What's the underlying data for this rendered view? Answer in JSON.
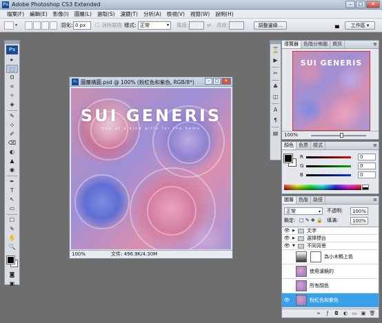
{
  "window": {
    "title": "Adobe Photoshop CS3 Extended",
    "logo": "Ps",
    "controls": [
      "–",
      "□",
      "✕"
    ]
  },
  "menu": [
    "檔案(F)",
    "編輯(E)",
    "影像(I)",
    "圖層(L)",
    "選取(S)",
    "濾鏡(T)",
    "分析(A)",
    "檢視(V)",
    "視窗(W)",
    "說明(H)"
  ],
  "options": {
    "feather_label": "羽化:",
    "feather_value": "0 px",
    "antialias_label": "消除鋸齒",
    "style_label": "樣式:",
    "style_value": "正常",
    "width_label": "寬度:",
    "height_label": "高度:",
    "refine_edge_button": "調整邊緣...",
    "workspace_button": "工作區"
  },
  "toolbox": {
    "logo": "Ps",
    "tools": [
      "▸",
      "⬚",
      "ʘ",
      "⌗",
      "✧",
      "◈",
      "✎",
      "⊹",
      "✐",
      "⌫",
      "◐",
      "▲",
      "◉",
      "✒",
      "T",
      "↖",
      "▭",
      "☐",
      "✎",
      "✋",
      "🔍"
    ]
  },
  "document": {
    "title": "圖層構圖.psd @ 100% (粉紅色和紫色, RGB/8*)",
    "headline": "SUI GENERIS",
    "subline": "One of a kind gifts for the home",
    "zoom": "100%",
    "file_size": "文件: 496.9K/4.30M"
  },
  "navigator": {
    "tabs": [
      "導覽器",
      "色階分佈圖",
      "資訊"
    ],
    "zoom": "100%"
  },
  "color_panel": {
    "tabs": [
      "顏色",
      "色票",
      "樣式"
    ],
    "channels": [
      {
        "label": "R",
        "value": "0",
        "color": "#d01010"
      },
      {
        "label": "G",
        "value": "0",
        "color": "#10a010"
      },
      {
        "label": "B",
        "value": "0",
        "color": "#1030d0"
      }
    ]
  },
  "layers_panel": {
    "tabs": [
      "圖層",
      "色版",
      "路徑"
    ],
    "blend_mode": "正常",
    "opacity_label": "不透明:",
    "opacity_value": "100%",
    "lock_label": "鎖定:",
    "fill_label": "填滿:",
    "fill_value": "100%",
    "layers": [
      {
        "name": "文字",
        "type": "group",
        "visible": true
      },
      {
        "name": "選擇標台",
        "type": "group",
        "visible": true
      },
      {
        "name": "不同背景",
        "type": "group-open",
        "visible": true
      },
      {
        "name": "為小木鴨上色",
        "type": "adjustment",
        "visible": false
      },
      {
        "name": "使用濾鏡的",
        "type": "image",
        "visible": false
      },
      {
        "name": "所有顏色",
        "type": "image",
        "visible": false
      },
      {
        "name": "粉紅色和紫色",
        "type": "image",
        "visible": true,
        "selected": true
      }
    ]
  }
}
